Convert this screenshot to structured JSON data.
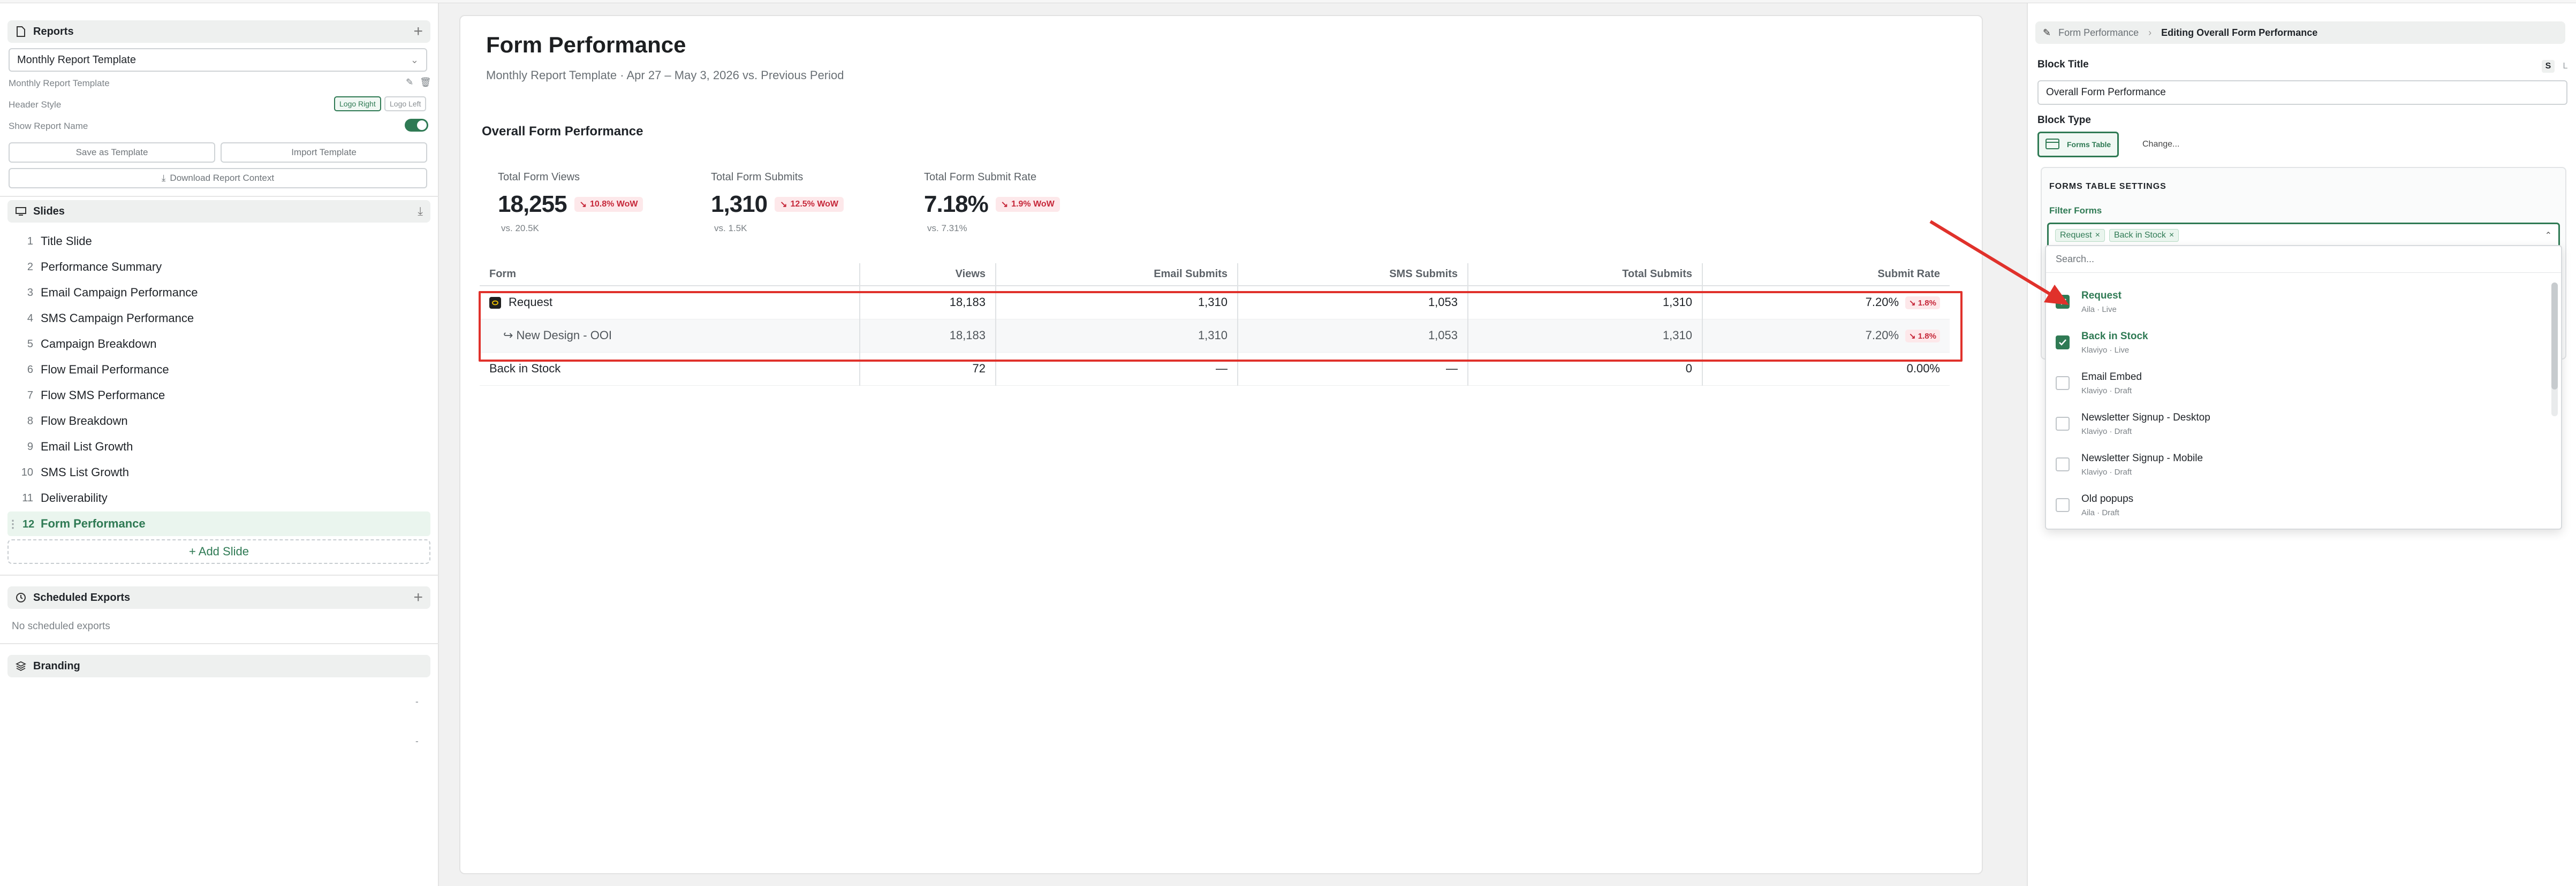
{
  "left": {
    "reports": {
      "title": "Reports",
      "selected": "Monthly Report Template",
      "name_line": "Monthly Report Template",
      "header_style_label": "Header Style",
      "logo_right": "Logo Right",
      "logo_left": "Logo Left",
      "show_name_label": "Show Report Name",
      "save_template": "Save as Template",
      "import_template": "Import Template",
      "download_context": "Download Report Context"
    },
    "slides": {
      "title": "Slides",
      "add": "+ Add Slide",
      "items": [
        {
          "num": "1",
          "label": "Title Slide"
        },
        {
          "num": "2",
          "label": "Performance Summary"
        },
        {
          "num": "3",
          "label": "Email Campaign Performance"
        },
        {
          "num": "4",
          "label": "SMS Campaign Performance"
        },
        {
          "num": "5",
          "label": "Campaign Breakdown"
        },
        {
          "num": "6",
          "label": "Flow Email Performance"
        },
        {
          "num": "7",
          "label": "Flow SMS Performance"
        },
        {
          "num": "8",
          "label": "Flow Breakdown"
        },
        {
          "num": "9",
          "label": "Email List Growth"
        },
        {
          "num": "10",
          "label": "SMS List Growth"
        },
        {
          "num": "11",
          "label": "Deliverability"
        },
        {
          "num": "12",
          "label": "Form Performance"
        }
      ]
    },
    "scheduled": {
      "title": "Scheduled Exports",
      "empty": "No scheduled exports"
    },
    "branding": {
      "title": "Branding",
      "dash1": "-",
      "dash2": "-"
    }
  },
  "main": {
    "title": "Form Performance",
    "subtitle": "Monthly Report Template  ·  Apr 27 – May 3, 2026 vs. Previous Period",
    "block_title": "Overall Form Performance",
    "metrics": [
      {
        "label": "Total Form Views",
        "value": "18,255",
        "change": "10.8% WoW",
        "vs": "vs. 20.5K"
      },
      {
        "label": "Total Form Submits",
        "value": "1,310",
        "change": "12.5% WoW",
        "vs": "vs. 1.5K"
      },
      {
        "label": "Total Form Submit Rate",
        "value": "7.18%",
        "change": "1.9% WoW",
        "vs": "vs. 7.31%"
      }
    ],
    "table": {
      "headers": [
        "Form",
        "Views",
        "Email Submits",
        "SMS Submits",
        "Total Submits",
        "Submit Rate"
      ],
      "rows": [
        {
          "form": "Request",
          "views": "18,183",
          "email": "1,310",
          "sms": "1,053",
          "total": "1,310",
          "rate": "7.20%",
          "rate_change": "1.8%"
        },
        {
          "form": "↪  New Design - OOI",
          "views": "18,183",
          "email": "1,310",
          "sms": "1,053",
          "total": "1,310",
          "rate": "7.20%",
          "rate_change": "1.8%"
        },
        {
          "form": "Back in Stock",
          "views": "72",
          "email": "—",
          "sms": "—",
          "total": "0",
          "rate": "0.00%"
        }
      ]
    }
  },
  "right": {
    "crumb_parent": "Form Performance",
    "crumb_current": "Editing Overall Form Performance",
    "block_title_label": "Block Title",
    "block_title_value": "Overall Form Performance",
    "size_s": "S",
    "size_l": "L",
    "block_type_label": "Block Type",
    "block_type_value": "Forms Table",
    "change": "Change...",
    "settings_title": "FORMS TABLE SETTINGS",
    "filter_label": "Filter Forms",
    "chips": [
      "Request",
      "Back in Stock"
    ],
    "search_placeholder": "Search...",
    "options": [
      {
        "name": "Request",
        "sub": "Aila · Live",
        "checked": true
      },
      {
        "name": "Back in Stock",
        "sub": "Klaviyo · Live",
        "checked": true
      },
      {
        "name": "Email Embed",
        "sub": "Klaviyo · Draft",
        "checked": false
      },
      {
        "name": "Newsletter Signup - Desktop",
        "sub": "Klaviyo · Draft",
        "checked": false
      },
      {
        "name": "Newsletter Signup - Mobile",
        "sub": "Klaviyo · Draft",
        "checked": false
      },
      {
        "name": "Old popups",
        "sub": "Aila · Draft",
        "checked": false
      }
    ]
  },
  "colors": {
    "accent": "#2f7a54",
    "danger": "#c6283a",
    "highlight": "#e0312b"
  }
}
